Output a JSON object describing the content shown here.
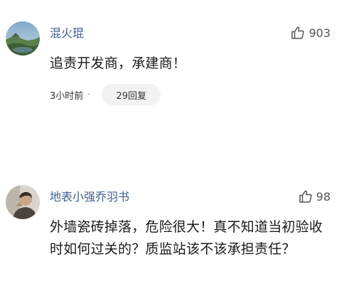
{
  "comments": [
    {
      "username": "混火琨",
      "likes": "903",
      "text": "追责开发商，承建商！",
      "time": "3小时前",
      "dot": "·",
      "replies": "29回复",
      "avatar_icon": "scenic-landscape-avatar"
    },
    {
      "username": "地表小强乔羽书",
      "likes": "98",
      "text": "外墙瓷砖掉落，危险很大！真不知道当初验收时如何过关的？质监站该不该承担责任？",
      "avatar_icon": "person-photo-avatar"
    }
  ],
  "colors": {
    "username": "#3f5f8f",
    "body_text": "#1a1a1a",
    "reply_pill_bg": "#f2f2f2"
  }
}
